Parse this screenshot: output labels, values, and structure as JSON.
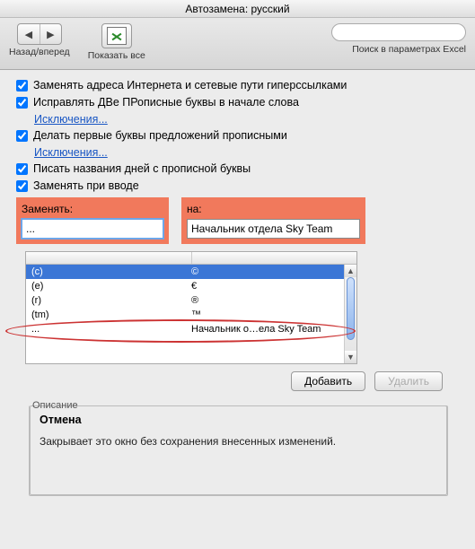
{
  "window": {
    "title": "Автозамена: русский"
  },
  "toolbar": {
    "back_label": "Назад/вперед",
    "showall_label": "Показать все",
    "search_placeholder": "",
    "search_caption": "Поиск в параметрах Excel"
  },
  "checkboxes": {
    "c1": "Заменять адреса Интернета и сетевые пути гиперссылками",
    "c2": "Исправлять ДВе ПРописные буквы в начале слова",
    "c2_link": "Исключения...",
    "c3": "Делать первые буквы предложений прописными",
    "c3_link": "Исключения...",
    "c4": "Писать названия дней с прописной буквы",
    "c5": "Заменять при вводе"
  },
  "fields": {
    "replace_label": "Заменять:",
    "replace_value": "...",
    "with_label": "на:",
    "with_value": "Начальник отдела Sky Team"
  },
  "list": {
    "rows": [
      {
        "a": "(c)",
        "b": "©"
      },
      {
        "a": "(e)",
        "b": "€"
      },
      {
        "a": "(r)",
        "b": "®"
      },
      {
        "a": "(tm)",
        "b": "™"
      },
      {
        "a": "...",
        "b": "Начальник о…ела Sky Team"
      }
    ]
  },
  "buttons": {
    "add": "Добавить",
    "delete": "Удалить"
  },
  "description": {
    "legend": "Описание",
    "title": "Отмена",
    "text": "Закрывает это окно без сохранения внесенных изменений."
  }
}
